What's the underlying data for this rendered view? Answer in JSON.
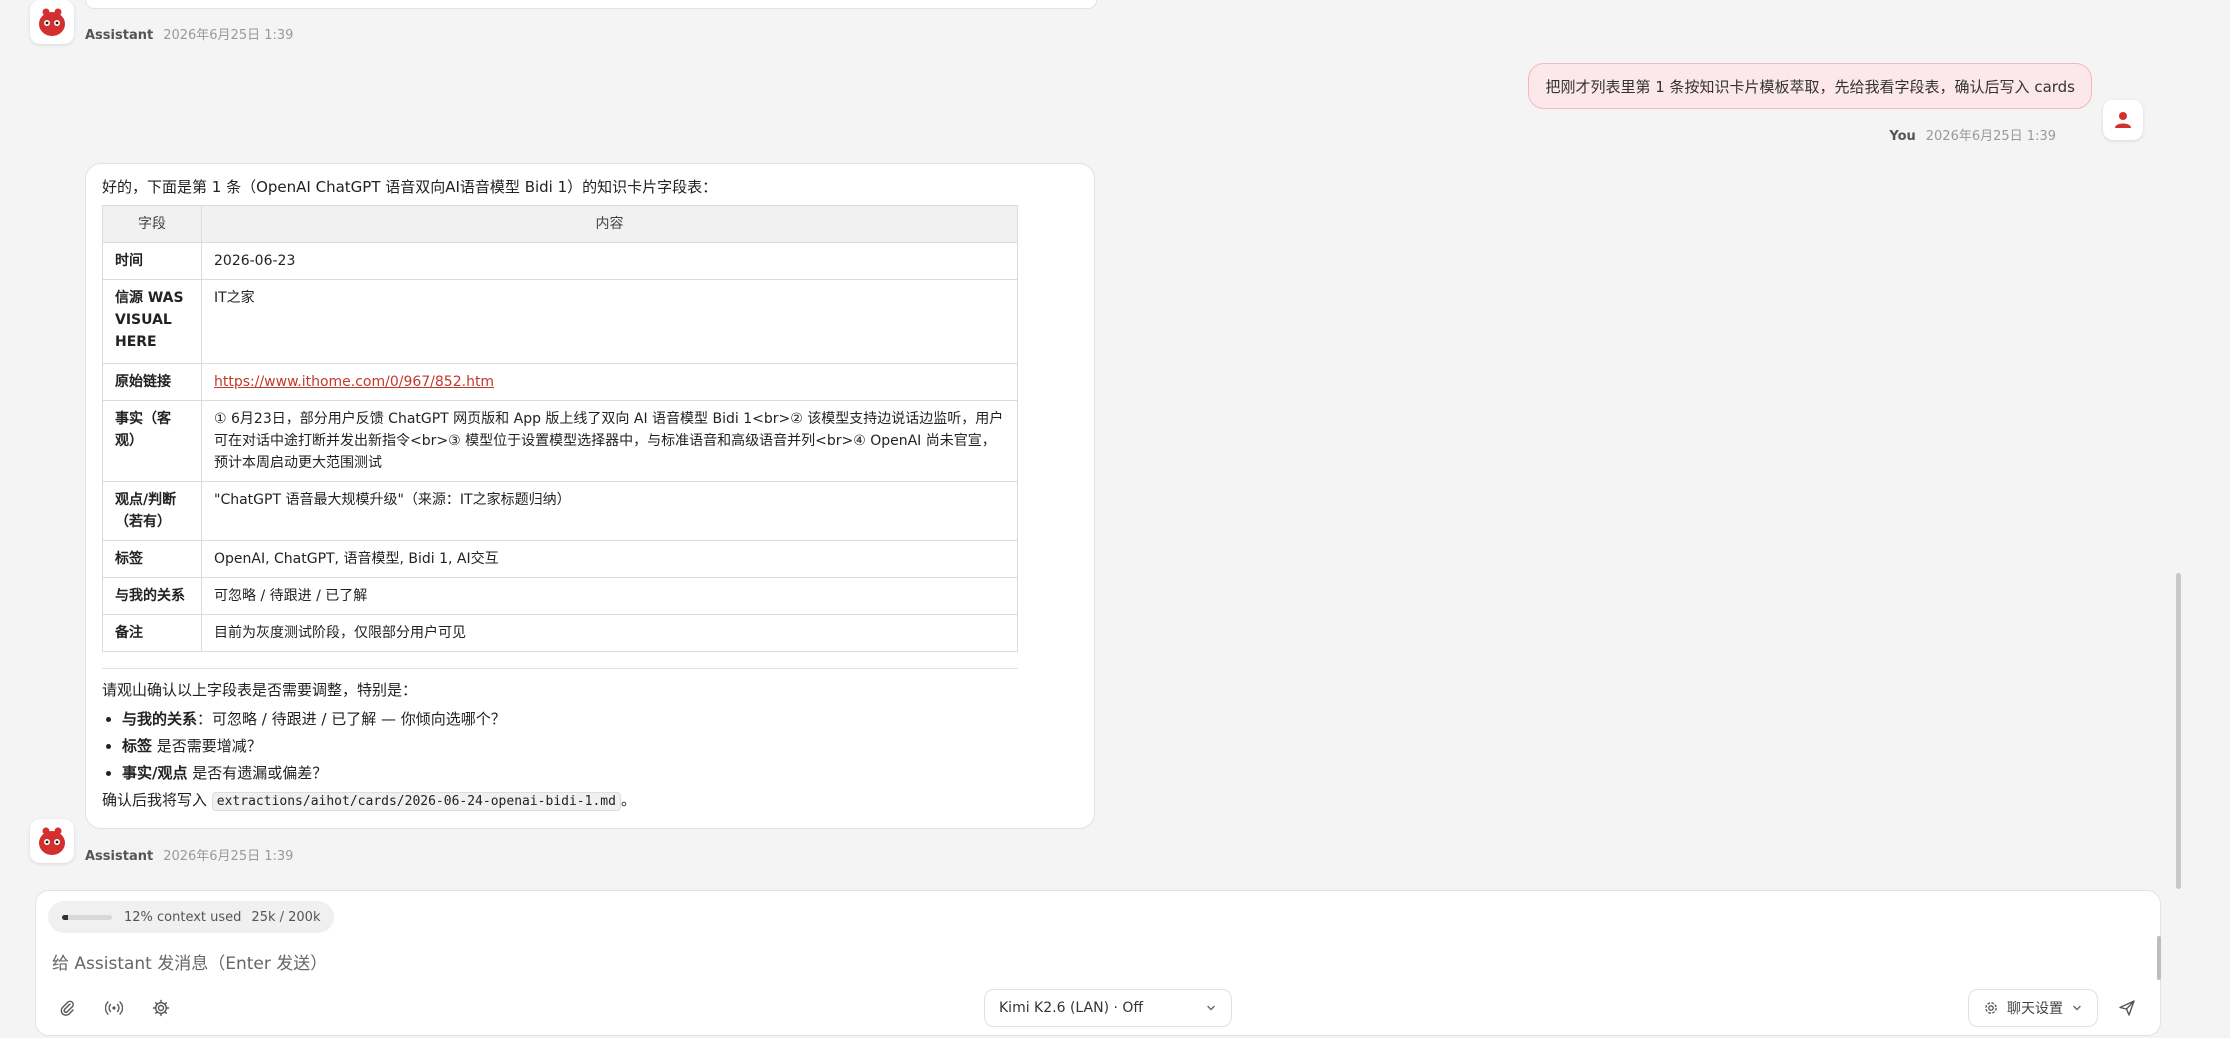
{
  "top_message": {
    "sender": "Assistant",
    "time": "2026年6月25日 1:39"
  },
  "user_message": {
    "text": "把刚才列表里第 1 条按知识卡片模板萃取，先给我看字段表，确认后写入 cards",
    "sender": "You",
    "time": "2026年6月25日 1:39"
  },
  "assistant_message": {
    "intro": "好的，下面是第 1 条（OpenAI ChatGPT 语音双向AI语音模型 Bidi 1）的知识卡片字段表：",
    "table": {
      "headers": [
        "字段",
        "内容"
      ],
      "rows": [
        {
          "key": "时间",
          "value": "2026-06-23"
        },
        {
          "key": "信源 WAS VISUAL HERE",
          "value": "IT之家"
        },
        {
          "key": "原始链接",
          "value": "https://www.ithome.com/0/967/852.htm",
          "link": true
        },
        {
          "key": "事实（客观）",
          "value": "① 6月23日，部分用户反馈 ChatGPT 网页版和 App 版上线了双向 AI 语音模型 Bidi 1<br>② 该模型支持边说话边监听，用户可在对话中途打断并发出新指令<br>③ 模型位于设置模型选择器中，与标准语音和高级语音并列<br>④ OpenAI 尚未官宣，预计本周启动更大范围测试"
        },
        {
          "key": "观点/判断（若有）",
          "value": "\"ChatGPT 语音最大规模升级\"（来源：IT之家标题归纳）"
        },
        {
          "key": "标签",
          "value": "OpenAI, ChatGPT, 语音模型, Bidi 1, AI交互"
        },
        {
          "key": "与我的关系",
          "value": "可忽略 / 待跟进 / 已了解"
        },
        {
          "key": "备注",
          "value": "目前为灰度测试阶段，仅限部分用户可见"
        }
      ]
    },
    "question": "请观山确认以上字段表是否需要调整，特别是：",
    "bullets": [
      {
        "bold": "与我的关系",
        "rest": "：可忽略 / 待跟进 / 已了解 — 你倾向选哪个？"
      },
      {
        "bold": "标签",
        "rest": " 是否需要增减？"
      },
      {
        "bold": "事实/观点",
        "rest": " 是否有遗漏或偏差？"
      }
    ],
    "confirm_prefix": "确认后我将写入 ",
    "confirm_path": "extractions/aihot/cards/2026-06-24-openai-bidi-1.md",
    "confirm_suffix": "。",
    "sender": "Assistant",
    "time": "2026年6月25日 1:39"
  },
  "composer": {
    "context_label": "12% context used",
    "context_tokens": "25k / 200k",
    "context_fraction": 0.12,
    "placeholder": "给 Assistant 发消息（Enter 发送）",
    "model_label": "Kimi K2.6 (LAN) · Off",
    "settings_label": "聊天设置"
  },
  "colors": {
    "accent": "#d32f2f",
    "user_bubble_bg": "#fce8ea",
    "user_bubble_border": "#f2b8bf",
    "link": "#c0392b"
  }
}
